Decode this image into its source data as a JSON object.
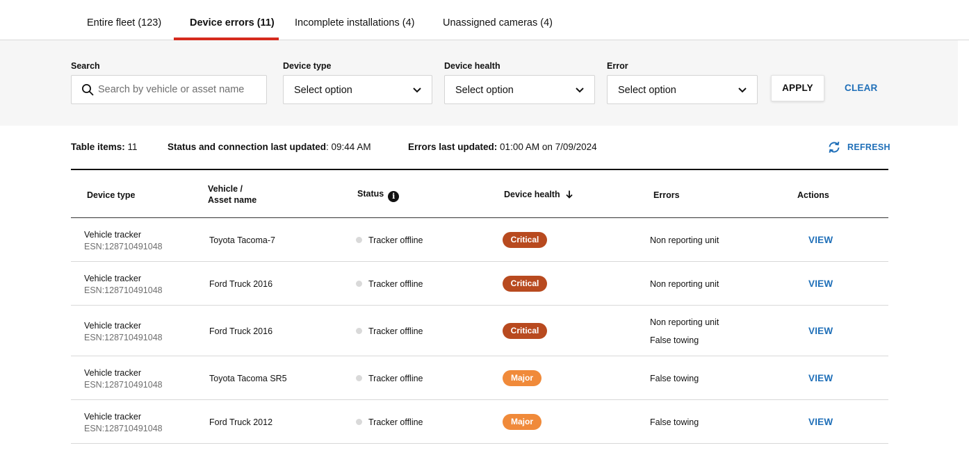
{
  "tabs": [
    {
      "label": "Entire fleet (123)",
      "active": false
    },
    {
      "label": "Device errors (11)",
      "active": true
    },
    {
      "label": "Incomplete installations (4)",
      "active": false
    },
    {
      "label": "Unassigned cameras (4)",
      "active": false
    }
  ],
  "filters": {
    "search": {
      "label": "Search",
      "placeholder": "Search by vehicle or asset name",
      "value": ""
    },
    "device_type": {
      "label": "Device type",
      "value": "Select option"
    },
    "device_health": {
      "label": "Device health",
      "value": "Select option"
    },
    "error": {
      "label": "Error",
      "value": "Select option"
    },
    "apply_label": "APPLY",
    "clear_label": "CLEAR"
  },
  "info_bar": {
    "table_items_label": "Table items:",
    "table_items_value": "11",
    "status_label": "Status and connection last updated",
    "status_value": ": 09:44 AM",
    "errors_label": "Errors last updated:",
    "errors_value": "01:00 AM on 7/09/2024",
    "refresh_label": "REFRESH"
  },
  "table": {
    "headers": {
      "device_type": "Device type",
      "vehicle_line1": "Vehicle /",
      "vehicle_line2": "Asset name",
      "status": "Status",
      "device_health": "Device health",
      "errors": "Errors",
      "actions": "Actions"
    },
    "rows": [
      {
        "device": "Vehicle tracker",
        "esn": "ESN:128710491048",
        "vehicle": "Toyota Tacoma-7",
        "status": "Tracker offline",
        "health": "Critical",
        "errors": [
          "Non reporting unit"
        ],
        "action": "VIEW"
      },
      {
        "device": "Vehicle tracker",
        "esn": "ESN:128710491048",
        "vehicle": "Ford Truck 2016",
        "status": "Tracker offline",
        "health": "Critical",
        "errors": [
          "Non reporting unit"
        ],
        "action": "VIEW"
      },
      {
        "device": "Vehicle tracker",
        "esn": "ESN:128710491048",
        "vehicle": "Ford Truck 2016",
        "status": "Tracker offline",
        "health": "Critical",
        "errors": [
          "Non reporting unit",
          "False towing"
        ],
        "action": "VIEW"
      },
      {
        "device": "Vehicle tracker",
        "esn": "ESN:128710491048",
        "vehicle": "Toyota Tacoma SR5",
        "status": "Tracker offline",
        "health": "Major",
        "errors": [
          "False towing"
        ],
        "action": "VIEW"
      },
      {
        "device": "Vehicle tracker",
        "esn": "ESN:128710491048",
        "vehicle": "Ford Truck 2012",
        "status": "Tracker offline",
        "health": "Major",
        "errors": [
          "False towing"
        ],
        "action": "VIEW"
      }
    ]
  },
  "colors": {
    "accent_red": "#d52b1e",
    "link_blue": "#1f6fb8",
    "critical": "#b84a1f",
    "major": "#f08a3a",
    "offline_dot": "#d9d9d9"
  },
  "icons": [
    "search-icon",
    "chevron-down-icon",
    "refresh-icon",
    "info-icon",
    "arrow-down-icon"
  ]
}
